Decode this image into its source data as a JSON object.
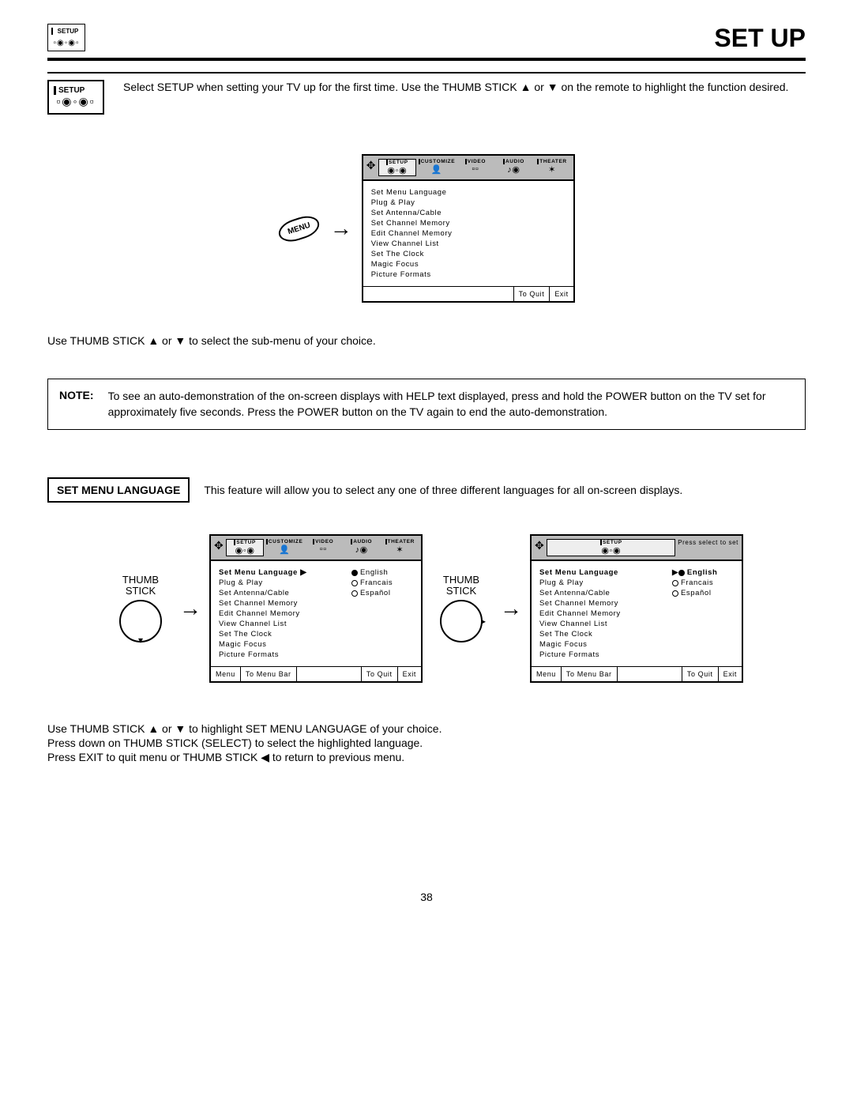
{
  "header": {
    "icon_label": "SETUP",
    "page_title": "Set Up"
  },
  "intro": {
    "icon_label": "SETUP",
    "text": "Select SETUP when setting your TV up for the first time.  Use the THUMB STICK ▲ or ▼ on the remote to highlight the function desired."
  },
  "menu_button": "MENU",
  "osd": {
    "tabs": [
      "SETUP",
      "CUSTOMIZE",
      "VIDEO",
      "AUDIO",
      "THEATER"
    ],
    "hint": "Press select to set",
    "items": [
      "Set Menu Language",
      "Plug & Play",
      "Set Antenna/Cable",
      "Set Channel Memory",
      "Edit Channel Memory",
      "View Channel List",
      "Set The Clock",
      "Magic Focus",
      "Picture Formats"
    ],
    "lang_opts": [
      "English",
      "Francais",
      "Español"
    ],
    "foot_menu": "Menu",
    "foot_bar": "To Menu Bar",
    "foot_quit": "To Quit",
    "foot_exit": "Exit"
  },
  "sub_instruction": "Use THUMB STICK ▲ or ▼ to select the sub-menu of your choice.",
  "note": {
    "label": "NOTE:",
    "text": "To see an auto-demonstration of the on-screen displays with HELP text displayed, press and hold the POWER button on the TV set for approximately five seconds. Press the POWER button on the TV again to end the auto-demonstration."
  },
  "section": {
    "title": "SET MENU LANGUAGE",
    "desc": "This feature will allow you to select any one of three different languages for all on-screen displays."
  },
  "thumb_label": "THUMB\nSTICK",
  "instructions": {
    "l1": "Use THUMB STICK ▲ or ▼ to highlight SET MENU LANGUAGE of your choice.",
    "l2": "Press down on THUMB STICK (SELECT) to select the highlighted language.",
    "l3": "Press EXIT to quit menu or THUMB STICK ◀ to return to previous menu."
  },
  "page_number": "38"
}
